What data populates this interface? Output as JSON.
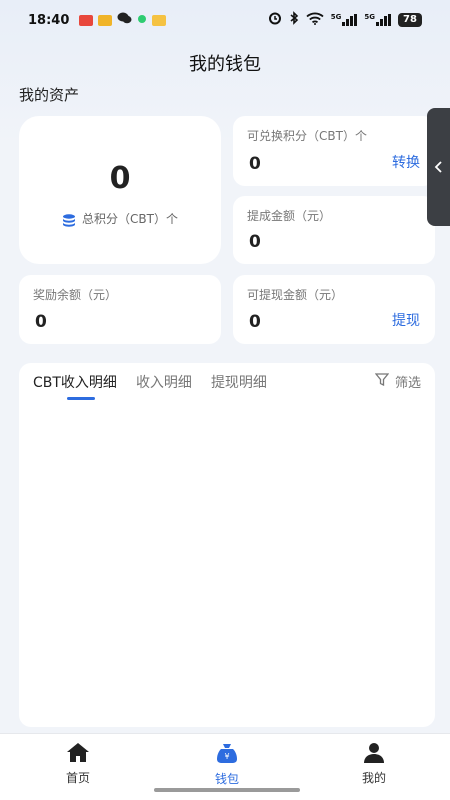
{
  "status_bar": {
    "time": "18:40",
    "network_label_1": "5G",
    "network_label_2": "5G",
    "battery": "78",
    "icons": [
      "notification-app-icon",
      "chat-icon",
      "wechat-icon",
      "dot-icon",
      "mail-icon",
      "alarm-icon",
      "bluetooth-icon",
      "wifi-icon",
      "signal-icon",
      "battery-icon"
    ]
  },
  "header": {
    "title": "我的钱包"
  },
  "assets": {
    "section_title": "我的资产",
    "total": {
      "value": "0",
      "label": "总积分（CBT）个"
    },
    "exchangeable": {
      "label": "可兑换积分（CBT）个",
      "value": "0",
      "action": "转换"
    },
    "commission": {
      "label": "提成金额（元）",
      "value": "0"
    },
    "reward": {
      "label": "奖励余额（元）",
      "value": "0"
    },
    "withdrawable": {
      "label": "可提现金额（元）",
      "value": "0",
      "action": "提现"
    }
  },
  "details": {
    "tabs": [
      {
        "label": "CBT收入明细",
        "active": true
      },
      {
        "label": "收入明细",
        "active": false
      },
      {
        "label": "提现明细",
        "active": false
      }
    ],
    "filter_label": "筛选"
  },
  "bottom_nav": {
    "items": [
      {
        "label": "首页",
        "icon": "home-icon",
        "active": false
      },
      {
        "label": "钱包",
        "icon": "wallet-icon",
        "active": true
      },
      {
        "label": "我的",
        "icon": "profile-icon",
        "active": false
      }
    ]
  },
  "colors": {
    "accent": "#2d6cdf",
    "background": "#f1f4f9",
    "card": "#ffffff"
  }
}
